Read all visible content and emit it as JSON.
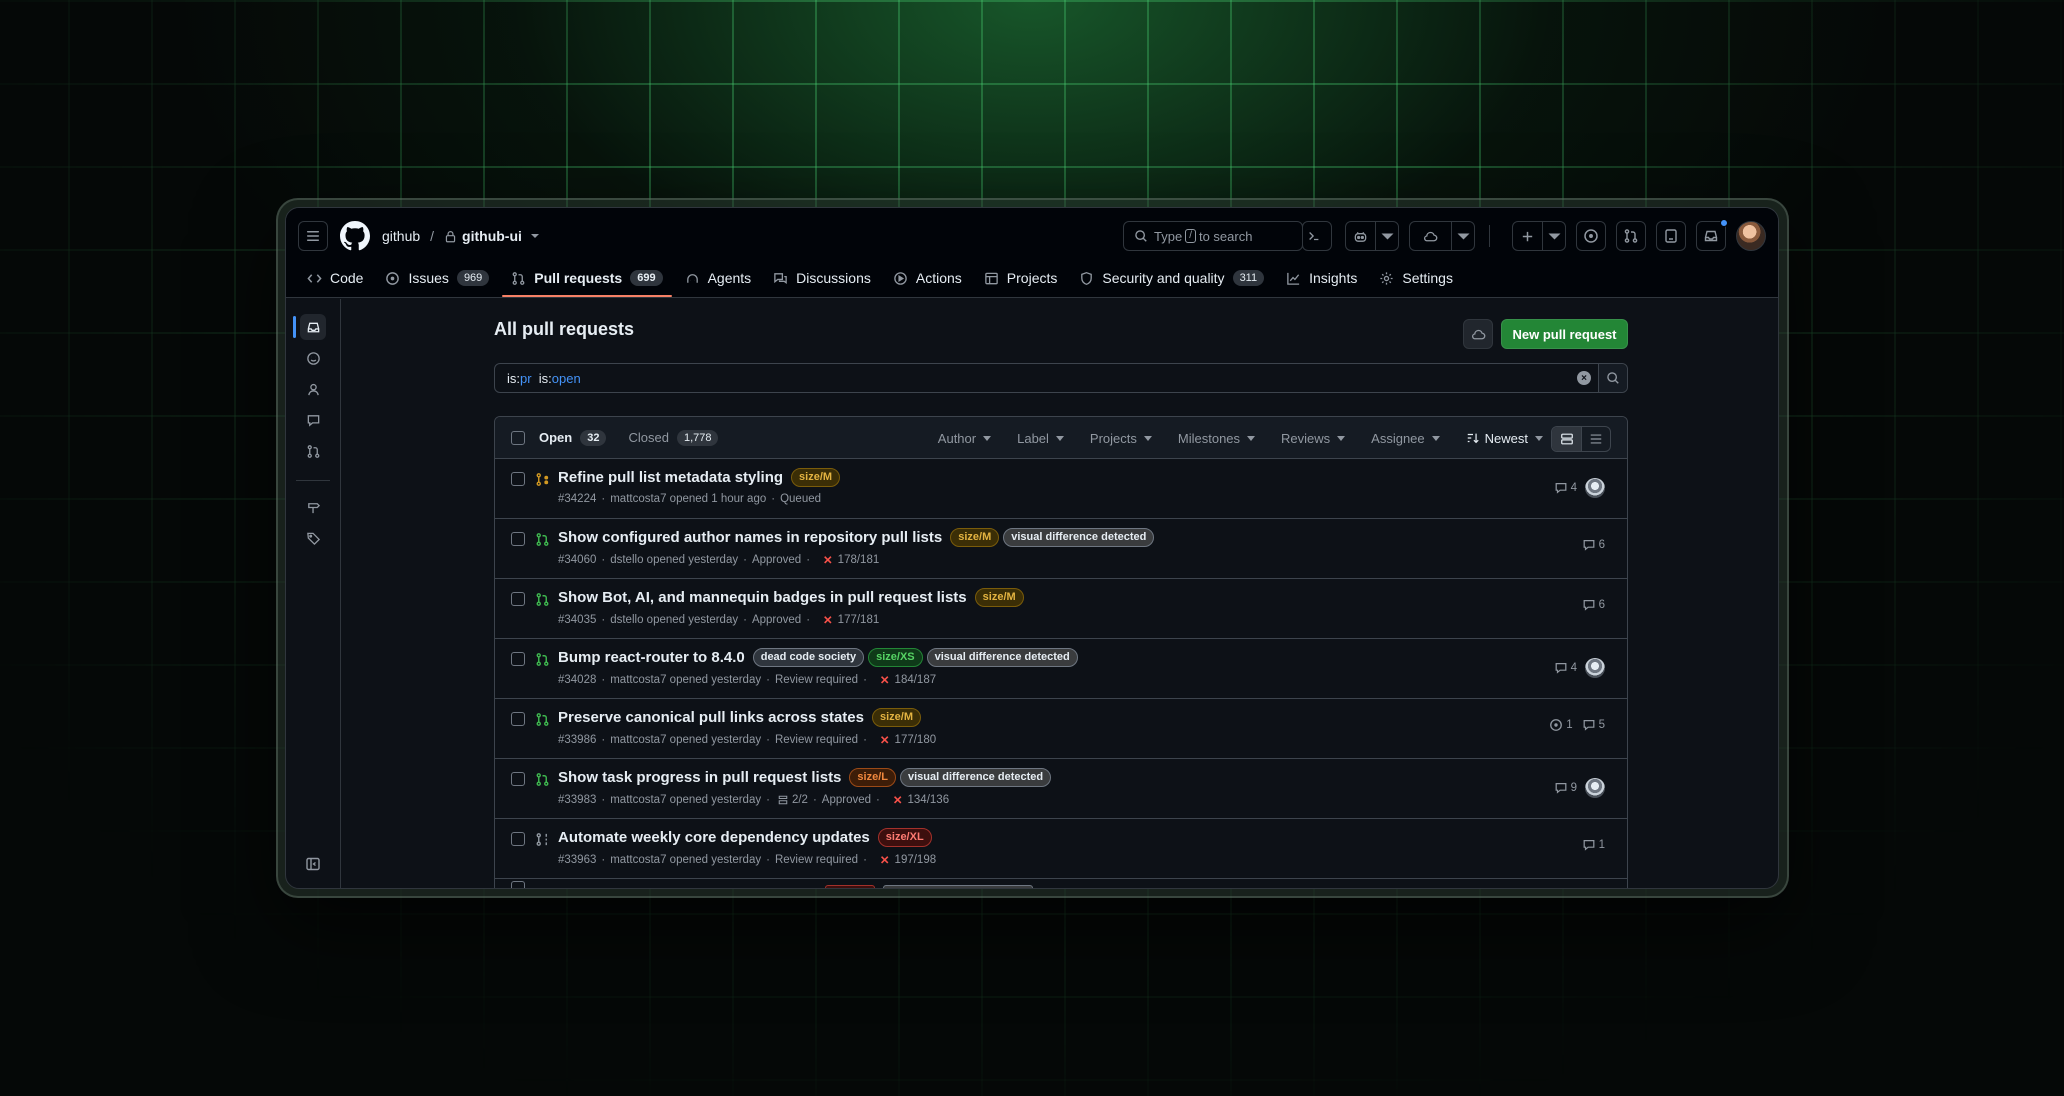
{
  "header": {
    "owner": "github",
    "separator": "/",
    "repo": "github-ui",
    "search": {
      "prefix": "Type",
      "key": "/",
      "suffix": "to search"
    }
  },
  "tabs": [
    {
      "label": "Code",
      "icon": "code-icon"
    },
    {
      "label": "Issues",
      "icon": "issue-icon",
      "count": "969"
    },
    {
      "label": "Pull requests",
      "icon": "pull-request-icon",
      "count": "699",
      "active": true
    },
    {
      "label": "Agents",
      "icon": "agent-icon"
    },
    {
      "label": "Discussions",
      "icon": "discussion-icon"
    },
    {
      "label": "Actions",
      "icon": "play-icon"
    },
    {
      "label": "Projects",
      "icon": "table-icon"
    },
    {
      "label": "Security and quality",
      "icon": "shield-icon",
      "count": "311"
    },
    {
      "label": "Insights",
      "icon": "graph-icon"
    },
    {
      "label": "Settings",
      "icon": "gear-icon"
    }
  ],
  "main": {
    "title": "All pull requests",
    "new_button": "New pull request",
    "query": {
      "k1": "is:",
      "v1": "pr",
      "k2": "is:",
      "v2": "open"
    }
  },
  "list": {
    "open_label": "Open",
    "open_count": "32",
    "closed_label": "Closed",
    "closed_count": "1,778",
    "filters": [
      "Author",
      "Label",
      "Projects",
      "Milestones",
      "Reviews",
      "Assignee"
    ],
    "sort": "Newest"
  },
  "prs": [
    {
      "title": "Refine pull list metadata styling",
      "labels": [
        {
          "text": "size/M",
          "kind": "m"
        }
      ],
      "number": "#34224",
      "author": "mattcosta7",
      "opened": "opened 1 hour ago",
      "status": "Queued",
      "checks": "",
      "tasks": "",
      "state": "queued",
      "comments": "4",
      "issues": "",
      "avatar": true
    },
    {
      "title": "Show configured author names in repository pull lists",
      "labels": [
        {
          "text": "size/M",
          "kind": "m"
        },
        {
          "text": "visual difference detected",
          "kind": "vd"
        }
      ],
      "number": "#34060",
      "author": "dstello",
      "opened": "opened yesterday",
      "status": "Approved",
      "checks": "178/181",
      "tasks": "",
      "state": "open",
      "comments": "6",
      "issues": "",
      "avatar": false
    },
    {
      "title": "Show Bot, AI, and mannequin badges in pull request lists",
      "labels": [
        {
          "text": "size/M",
          "kind": "m"
        }
      ],
      "number": "#34035",
      "author": "dstello",
      "opened": "opened yesterday",
      "status": "Approved",
      "checks": "177/181",
      "tasks": "",
      "state": "open",
      "comments": "6",
      "issues": "",
      "avatar": false
    },
    {
      "title": "Bump react-router to 8.4.0",
      "labels": [
        {
          "text": "dead code society",
          "kind": "dc"
        },
        {
          "text": "size/XS",
          "kind": "xs"
        },
        {
          "text": "visual difference detected",
          "kind": "vd"
        }
      ],
      "number": "#34028",
      "author": "mattcosta7",
      "opened": "opened yesterday",
      "status": "Review required",
      "checks": "184/187",
      "tasks": "",
      "state": "open",
      "comments": "4",
      "issues": "",
      "avatar": true
    },
    {
      "title": "Preserve canonical pull links across states",
      "labels": [
        {
          "text": "size/M",
          "kind": "m"
        }
      ],
      "number": "#33986",
      "author": "mattcosta7",
      "opened": "opened yesterday",
      "status": "Review required",
      "checks": "177/180",
      "tasks": "",
      "state": "open",
      "comments": "5",
      "issues": "1",
      "avatar": false
    },
    {
      "title": "Show task progress in pull request lists",
      "labels": [
        {
          "text": "size/L",
          "kind": "l"
        },
        {
          "text": "visual difference detected",
          "kind": "vd"
        }
      ],
      "number": "#33983",
      "author": "mattcosta7",
      "opened": "opened yesterday",
      "status": "Approved",
      "checks": "134/136",
      "tasks": "2/2",
      "state": "open",
      "comments": "9",
      "issues": "",
      "avatar": true
    },
    {
      "title": "Automate weekly core dependency updates",
      "labels": [
        {
          "text": "size/XL",
          "kind": "xl"
        }
      ],
      "number": "#33963",
      "author": "mattcosta7",
      "opened": "opened yesterday",
      "status": "Review required",
      "checks": "197/198",
      "tasks": "",
      "state": "draft",
      "comments": "1",
      "issues": "",
      "avatar": false
    }
  ],
  "colors": {
    "accent": "#f78166",
    "primary": "#238636",
    "link": "#4493f8",
    "open": "#3fb950",
    "fail": "#f85149"
  }
}
